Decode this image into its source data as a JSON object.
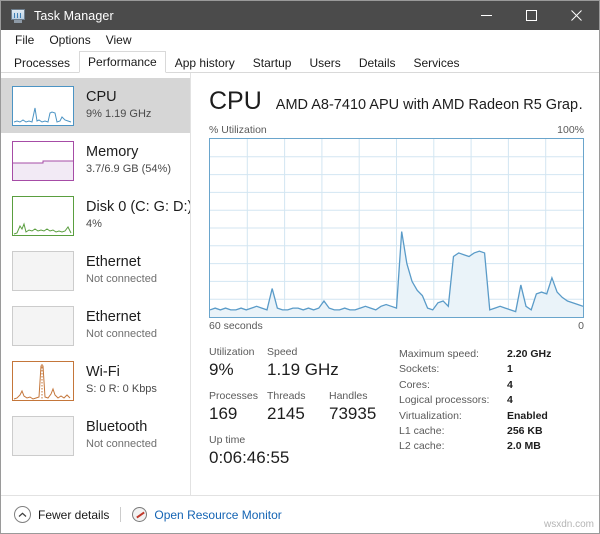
{
  "window": {
    "title": "Task Manager",
    "icon": "task-manager-icon",
    "controls": {
      "minimize": "–",
      "maximize": "□",
      "close": "✕"
    }
  },
  "menu": {
    "items": [
      "File",
      "Options",
      "View"
    ]
  },
  "tabs": {
    "items": [
      {
        "label": "Processes",
        "active": false
      },
      {
        "label": "Performance",
        "active": true
      },
      {
        "label": "App history",
        "active": false
      },
      {
        "label": "Startup",
        "active": false
      },
      {
        "label": "Users",
        "active": false
      },
      {
        "label": "Details",
        "active": false
      },
      {
        "label": "Services",
        "active": false
      }
    ]
  },
  "sidebar": {
    "items": [
      {
        "name": "CPU",
        "sub": "9%  1.19 GHz",
        "color": "#4c94c4",
        "selected": true,
        "style": "line"
      },
      {
        "name": "Memory",
        "sub": "3.7/6.9 GB (54%)",
        "color": "#a64ca6",
        "selected": false,
        "style": "memory"
      },
      {
        "name": "Disk 0 (C: G: D:)",
        "sub": "4%",
        "color": "#5a9e3f",
        "selected": false,
        "style": "line"
      },
      {
        "name": "Ethernet",
        "sub": "Not connected",
        "color": "#cccccc",
        "selected": false,
        "style": "empty"
      },
      {
        "name": "Ethernet",
        "sub": "Not connected",
        "color": "#cccccc",
        "selected": false,
        "style": "empty"
      },
      {
        "name": "Wi-Fi",
        "sub": "S: 0 R: 0 Kbps",
        "color": "#c4763a",
        "selected": false,
        "style": "wifi"
      },
      {
        "name": "Bluetooth",
        "sub": "Not connected",
        "color": "#cccccc",
        "selected": false,
        "style": "empty"
      }
    ]
  },
  "main": {
    "heading": "CPU",
    "model": "AMD A8-7410 APU with AMD Radeon R5 Grap…",
    "graph_top_left": "% Utilization",
    "graph_top_right": "100%",
    "graph_bottom_left": "60 seconds",
    "graph_bottom_right": "0",
    "stats": {
      "utilization_label": "Utilization",
      "utilization_value": "9%",
      "speed_label": "Speed",
      "speed_value": "1.19 GHz",
      "processes_label": "Processes",
      "processes_value": "169",
      "threads_label": "Threads",
      "threads_value": "2145",
      "handles_label": "Handles",
      "handles_value": "73935",
      "uptime_label": "Up time",
      "uptime_value": "0:06:46:55"
    },
    "specs": [
      {
        "key": "Maximum speed:",
        "value": "2.20 GHz"
      },
      {
        "key": "Sockets:",
        "value": "1"
      },
      {
        "key": "Cores:",
        "value": "4"
      },
      {
        "key": "Logical processors:",
        "value": "4"
      },
      {
        "key": "Virtualization:",
        "value": "Enabled"
      },
      {
        "key": "L1 cache:",
        "value": "256 KB"
      },
      {
        "key": "L2 cache:",
        "value": "2.0 MB"
      }
    ]
  },
  "footer": {
    "fewer_details": "Fewer details",
    "open_resource_monitor": "Open Resource Monitor"
  },
  "watermark": "wsxdn.com",
  "chart_data": {
    "type": "area",
    "title": "CPU % Utilization",
    "xlabel": "60 seconds",
    "ylabel": "% Utilization",
    "ylim": [
      0,
      100
    ],
    "xlim": [
      60,
      0
    ],
    "grid": true,
    "grid_columns": 10,
    "grid_rows": 10,
    "line_color": "#5a9bc8",
    "fill_color": "#eaf3f9",
    "series": [
      {
        "name": "CPU utilization",
        "values": [
          4,
          5,
          4,
          5,
          4,
          4,
          5,
          4,
          5,
          6,
          5,
          4,
          16,
          5,
          4,
          4,
          5,
          5,
          4,
          5,
          4,
          5,
          9,
          5,
          4,
          4,
          5,
          4,
          4,
          5,
          6,
          5,
          4,
          6,
          7,
          6,
          5,
          48,
          30,
          20,
          15,
          12,
          5,
          4,
          8,
          9,
          6,
          34,
          36,
          35,
          34,
          36,
          37,
          36,
          4,
          5,
          6,
          5,
          4,
          3,
          18,
          6,
          4,
          13,
          14,
          13,
          22,
          14,
          11,
          9,
          8,
          7,
          6
        ]
      }
    ]
  }
}
